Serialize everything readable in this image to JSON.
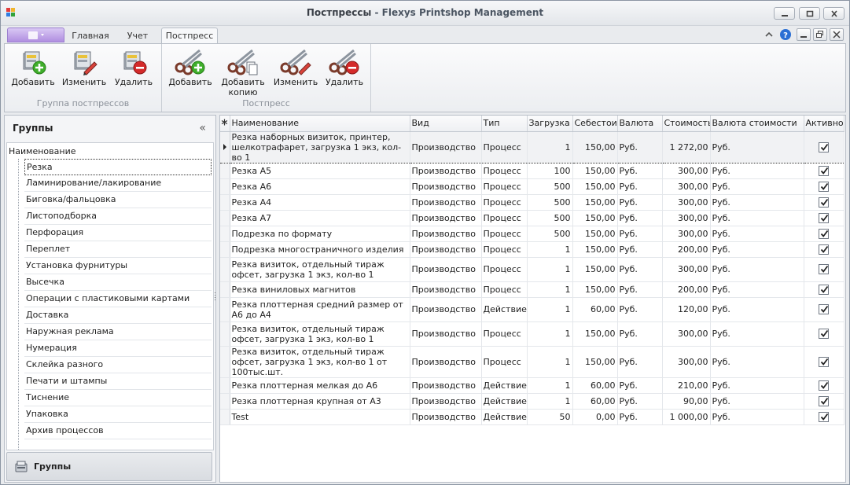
{
  "window": {
    "title_main": "Постпрессы",
    "title_app": " - Flexys Printshop Management"
  },
  "ribbon_tabs": [
    {
      "label": "Главная"
    },
    {
      "label": "Учет"
    },
    {
      "label": "Постпресс"
    }
  ],
  "ribbon": {
    "group1": {
      "label": "Группа постпрессов",
      "buttons": [
        {
          "label": "Добавить",
          "icon": "database-add-icon"
        },
        {
          "label": "Изменить",
          "icon": "database-edit-icon"
        },
        {
          "label": "Удалить",
          "icon": "database-delete-icon"
        }
      ]
    },
    "group2": {
      "label": "Постпресс",
      "buttons": [
        {
          "label": "Добавить",
          "icon": "scissors-add-icon"
        },
        {
          "label": "Добавить копию",
          "icon": "scissors-copy-icon"
        },
        {
          "label": "Изменить",
          "icon": "scissors-edit-icon"
        },
        {
          "label": "Удалить",
          "icon": "scissors-delete-icon"
        }
      ]
    }
  },
  "left_panel": {
    "title": "Группы",
    "collapse_glyph": "«",
    "tree_root": "Наименование",
    "items": [
      "Резка",
      "Ламинирование/лакирование",
      "Биговка/фальцовка",
      "Листоподборка",
      "Перфорация",
      "Переплет",
      "Установка фурнитуры",
      "Высечка",
      "Операции с пластиковыми картами",
      "Доставка",
      "Наружная реклама",
      "Нумерация",
      "Склейка разного",
      "Печати и штампы",
      "Тиснение",
      "Упаковка",
      "Архив процессов"
    ],
    "selected_index": 0,
    "footer_label": "Группы"
  },
  "grid": {
    "columns": [
      "Наименование",
      "Вид",
      "Тип",
      "Загрузка",
      "Себестоим",
      "Валюта",
      "Стоимость",
      "Валюта стоимости",
      "Активно"
    ],
    "rows": [
      {
        "name": "Резка наборных визиток,  принтер, шелкотрафарет, загрузка  1 экз, кол-во 1",
        "kind": "Производство",
        "type": "Процесс",
        "load": "1",
        "cost": "150,00",
        "currency": "Руб.",
        "price": "1 272,00",
        "price_currency": "Руб.",
        "active": true,
        "tall": true,
        "selected": true
      },
      {
        "name": "Резка А5",
        "kind": "Производство",
        "type": "Процесс",
        "load": "100",
        "cost": "150,00",
        "currency": "Руб.",
        "price": "300,00",
        "price_currency": "Руб.",
        "active": true
      },
      {
        "name": "Резка А6",
        "kind": "Производство",
        "type": "Процесс",
        "load": "500",
        "cost": "150,00",
        "currency": "Руб.",
        "price": "300,00",
        "price_currency": "Руб.",
        "active": true
      },
      {
        "name": "Резка А4",
        "kind": "Производство",
        "type": "Процесс",
        "load": "500",
        "cost": "150,00",
        "currency": "Руб.",
        "price": "300,00",
        "price_currency": "Руб.",
        "active": true
      },
      {
        "name": "Резка А7",
        "kind": "Производство",
        "type": "Процесс",
        "load": "500",
        "cost": "150,00",
        "currency": "Руб.",
        "price": "300,00",
        "price_currency": "Руб.",
        "active": true
      },
      {
        "name": "Подрезка по формату",
        "kind": "Производство",
        "type": "Процесс",
        "load": "500",
        "cost": "150,00",
        "currency": "Руб.",
        "price": "300,00",
        "price_currency": "Руб.",
        "active": true
      },
      {
        "name": "Подрезка многостраничного изделия",
        "kind": "Производство",
        "type": "Процесс",
        "load": "1",
        "cost": "150,00",
        "currency": "Руб.",
        "price": "200,00",
        "price_currency": "Руб.",
        "active": true
      },
      {
        "name": "Резка визиток, отдельный тираж офсет, загрузка 1 экз, кол-во 1",
        "kind": "Производство",
        "type": "Процесс",
        "load": "1",
        "cost": "150,00",
        "currency": "Руб.",
        "price": "300,00",
        "price_currency": "Руб.",
        "active": true,
        "tall": true
      },
      {
        "name": "Резка виниловых магнитов",
        "kind": "Производство",
        "type": "Процесс",
        "load": "1",
        "cost": "150,00",
        "currency": "Руб.",
        "price": "200,00",
        "price_currency": "Руб.",
        "active": true
      },
      {
        "name": "Резка плоттерная средний размер от А6 до А4",
        "kind": "Производство",
        "type": "Действие",
        "load": "1",
        "cost": "60,00",
        "currency": "Руб.",
        "price": "120,00",
        "price_currency": "Руб.",
        "active": true,
        "tall": true
      },
      {
        "name": "Резка визиток, отдельный тираж офсет, загрузка 1 экз, кол-во 1",
        "kind": "Производство",
        "type": "Процесс",
        "load": "1",
        "cost": "150,00",
        "currency": "Руб.",
        "price": "300,00",
        "price_currency": "Руб.",
        "active": true,
        "tall": true
      },
      {
        "name": "Резка визиток, отдельный тираж офсет, загрузка 1 экз, кол-во 1 от 100тыс.шт.",
        "kind": "Производство",
        "type": "Процесс",
        "load": "1",
        "cost": "150,00",
        "currency": "Руб.",
        "price": "300,00",
        "price_currency": "Руб.",
        "active": true,
        "tall": true
      },
      {
        "name": "Резка плоттерная мелкая до А6",
        "kind": "Производство",
        "type": "Действие",
        "load": "1",
        "cost": "60,00",
        "currency": "Руб.",
        "price": "210,00",
        "price_currency": "Руб.",
        "active": true
      },
      {
        "name": "Резка плоттерная крупная от А3",
        "kind": "Производство",
        "type": "Действие",
        "load": "1",
        "cost": "60,00",
        "currency": "Руб.",
        "price": "90,00",
        "price_currency": "Руб.",
        "active": true
      },
      {
        "name": "Test",
        "kind": "Производство",
        "type": "Действие",
        "load": "50",
        "cost": "0,00",
        "currency": "Руб.",
        "price": "1 000,00",
        "price_currency": "Руб.",
        "active": true
      }
    ]
  },
  "colors": {
    "app_menu_accent": "#b08ee0",
    "add_green": "#3fae2a",
    "delete_red": "#d42a2a",
    "help_blue": "#2a6fd4"
  }
}
